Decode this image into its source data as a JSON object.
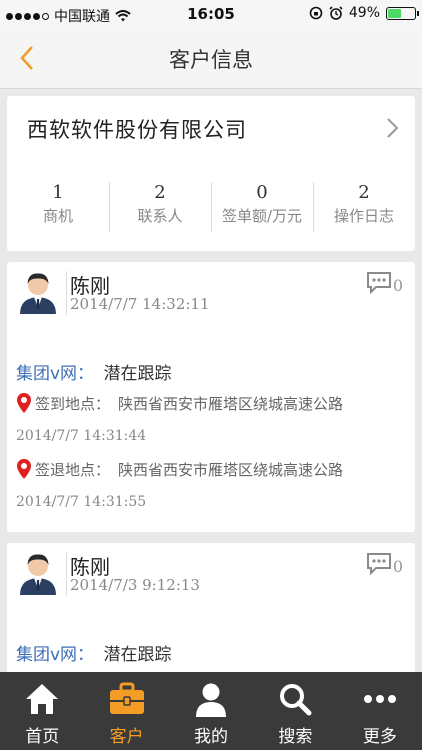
{
  "status_bar": {
    "carrier": "中国联通",
    "time": "16:05",
    "battery": "49%",
    "battery_level": 0.49
  },
  "nav": {
    "title": "客户信息",
    "accent": "#f39c26"
  },
  "company": {
    "name": "西软软件股份有限公司",
    "stats": [
      {
        "value": "1",
        "label": "商机"
      },
      {
        "value": "2",
        "label": "联系人"
      },
      {
        "value": "0",
        "label": "签单额/万元"
      },
      {
        "value": "2",
        "label": "操作日志"
      }
    ]
  },
  "records": [
    {
      "name": "陈刚",
      "time": "2014/7/7 14:32:11",
      "comments": "0",
      "group_label": "集团v网：",
      "group_value": "潜在跟踪",
      "checkin_label": "签到地点：",
      "checkin_address": "陕西省西安市雁塔区绕城高速公路",
      "checkin_time": "2014/7/7 14:31:44",
      "checkout_label": "签退地点：",
      "checkout_address": "陕西省西安市雁塔区绕城高速公路",
      "checkout_time": "2014/7/7 14:31:55"
    },
    {
      "name": "陈刚",
      "time": "2014/7/3 9:12:13",
      "comments": "0",
      "group_label": "集团v网：",
      "group_value": "潜在跟踪"
    }
  ],
  "tabs": [
    {
      "label": "首页",
      "icon": "home-icon"
    },
    {
      "label": "客户",
      "icon": "briefcase-icon",
      "active": true
    },
    {
      "label": "我的",
      "icon": "person-icon"
    },
    {
      "label": "搜索",
      "icon": "search-icon"
    },
    {
      "label": "更多",
      "icon": "more-icon"
    }
  ]
}
